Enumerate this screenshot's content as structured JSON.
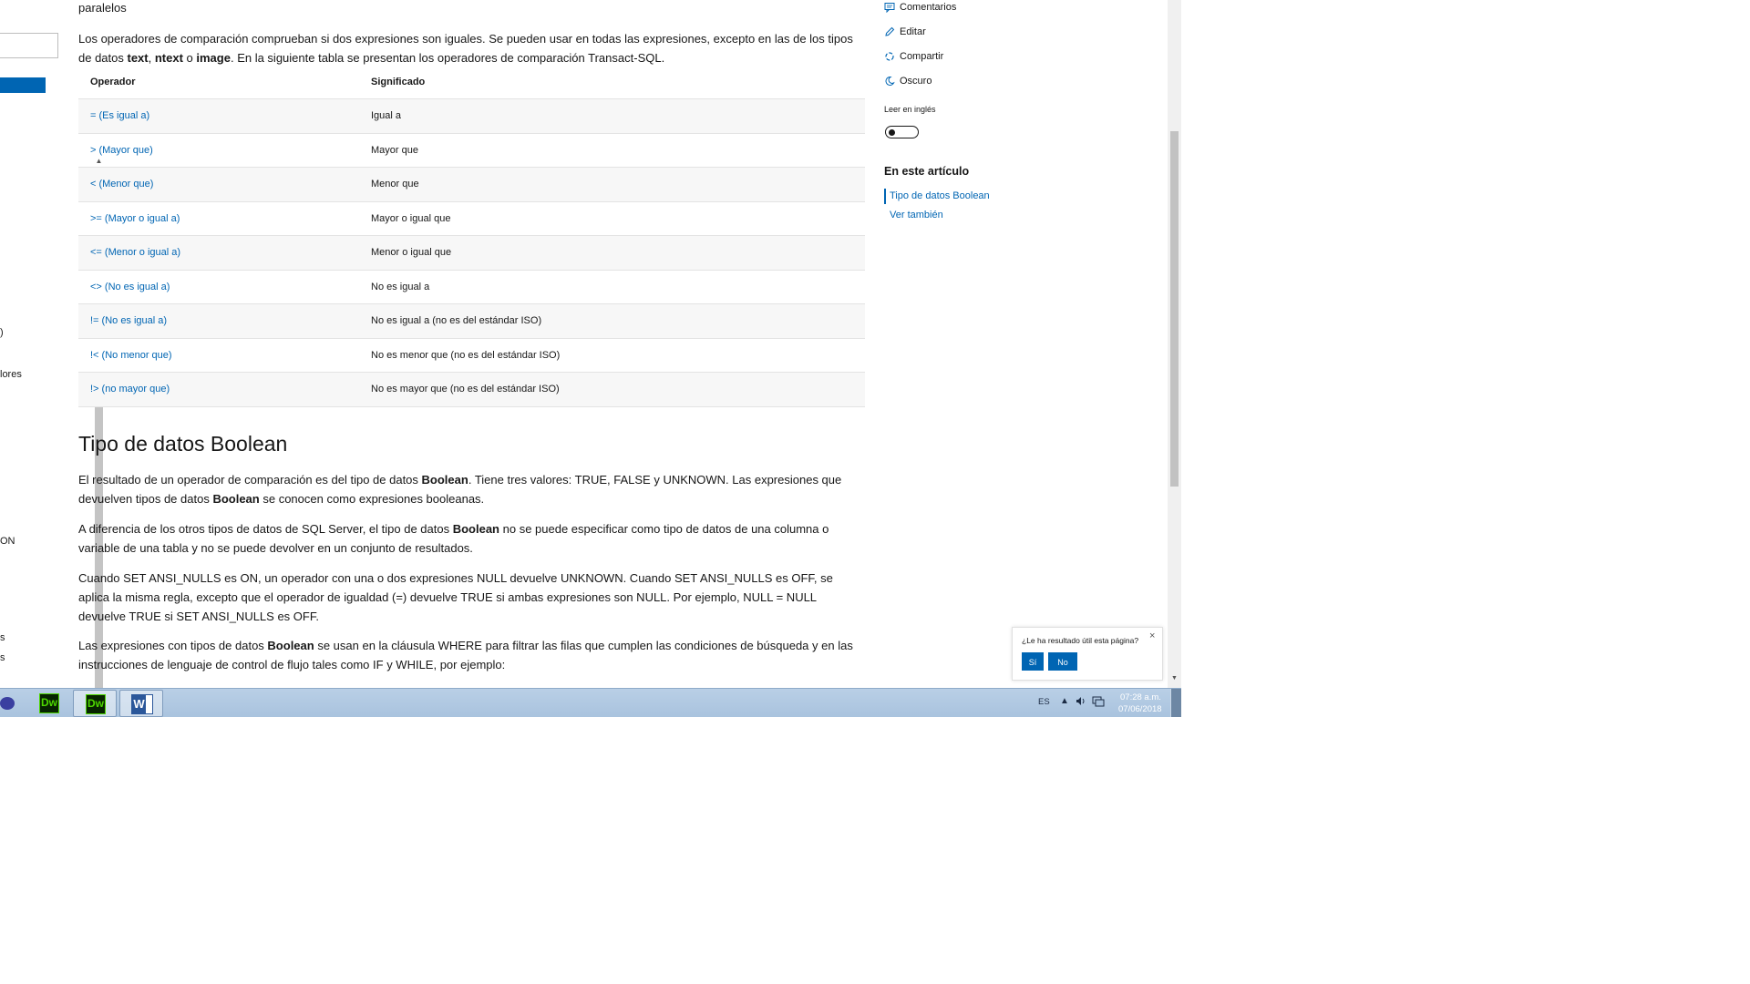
{
  "article": {
    "top_fragment": "paralelos",
    "intro": {
      "t1": "Los operadores de comparación comprueban si dos expresiones son iguales. Se pueden usar en todas las expresiones, excepto en las de los tipos de datos ",
      "b1": "text",
      "t2": ", ",
      "b2": "ntext",
      "t3": " o ",
      "b3": "image",
      "t4": ". En la siguiente tabla se presentan los operadores de comparación Transact-SQL."
    },
    "table": {
      "headers": [
        "Operador",
        "Significado"
      ],
      "rows": [
        {
          "op": "= (Es igual a)",
          "meaning": "Igual a"
        },
        {
          "op": "> (Mayor que)",
          "meaning": "Mayor que"
        },
        {
          "op": "< (Menor que)",
          "meaning": "Menor que"
        },
        {
          "op": ">= (Mayor o igual a)",
          "meaning": "Mayor o igual que"
        },
        {
          "op": "<= (Menor o igual a)",
          "meaning": "Menor o igual que"
        },
        {
          "op": "<> (No es igual a)",
          "meaning": "No es igual a"
        },
        {
          "op": "!= (No es igual a)",
          "meaning": "No es igual a (no es del estándar ISO)"
        },
        {
          "op": "!< (No menor que)",
          "meaning": "No es menor que (no es del estándar ISO)"
        },
        {
          "op": "!> (no mayor que)",
          "meaning": "No es mayor que (no es del estándar ISO)"
        }
      ]
    },
    "boolean_heading": "Tipo de datos Boolean",
    "p1": {
      "t1": "El resultado de un operador de comparación es del tipo de datos ",
      "b1": "Boolean",
      "t2": ". Tiene tres valores: TRUE, FALSE y UNKNOWN. Las expresiones que devuelven tipos de datos ",
      "b2": "Boolean",
      "t3": " se conocen como expresiones booleanas."
    },
    "p2": {
      "t1": "A diferencia de los otros tipos de datos de SQL Server, el tipo de datos ",
      "b1": "Boolean",
      "t2": " no se puede especificar como tipo de datos de una columna o variable de una tabla y no se puede devolver en un conjunto de resultados."
    },
    "p3": "Cuando SET ANSI_NULLS es ON, un operador con una o dos expresiones NULL devuelve UNKNOWN. Cuando SET ANSI_NULLS es OFF, se aplica la misma regla, excepto que el operador de igualdad (=) devuelve TRUE si ambas expresiones son NULL. Por ejemplo, NULL = NULL devuelve TRUE si SET ANSI_NULLS es OFF.",
    "p4": {
      "t1": "Las expresiones con tipos de datos ",
      "b1": "Boolean",
      "t2": " se usan en la cláusula WHERE para filtrar las filas que cumplen las condiciones de búsqueda y en las instrucciones de lenguaje de control de flujo tales como IF y WHILE, por ejemplo:"
    }
  },
  "leftnav": {
    "fragments": [
      ")",
      "lores",
      "ON",
      "s",
      "s"
    ]
  },
  "rail": {
    "actions": {
      "comments": "Comentarios",
      "edit": "Editar",
      "share": "Compartir",
      "dark": "Oscuro"
    },
    "read_english_label": "Leer en inglés",
    "read_english_on": false,
    "in_this_article": "En este artículo",
    "toc": [
      "Tipo de datos Boolean",
      "Ver también"
    ]
  },
  "feedback": {
    "question": "¿Le ha resultado útil esta página?",
    "yes": "Sí",
    "no": "No",
    "close": "×"
  },
  "taskbar": {
    "lang": "ES",
    "time": "07:28 a.m.",
    "date": "07/06/2018",
    "apps": [
      {
        "name": "dreamweaver",
        "label": "Dw"
      },
      {
        "name": "dreamweaver-active",
        "label": "Dw"
      },
      {
        "name": "word",
        "label": "W"
      }
    ]
  },
  "colors": {
    "accent": "#0065b3",
    "taskbar": "#a9c3de",
    "dreamweaver_green": "#4dd600"
  }
}
